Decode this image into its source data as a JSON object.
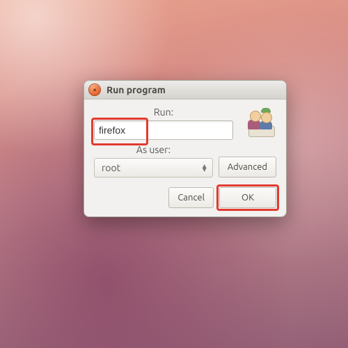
{
  "window": {
    "title": "Run program",
    "close_glyph": "×"
  },
  "run": {
    "label": "Run:",
    "value": "firefox"
  },
  "user": {
    "label": "As user:",
    "selected": "root"
  },
  "buttons": {
    "advanced": "Advanced",
    "cancel": "Cancel",
    "ok": "OK"
  },
  "highlight_color": "#e23b2f"
}
